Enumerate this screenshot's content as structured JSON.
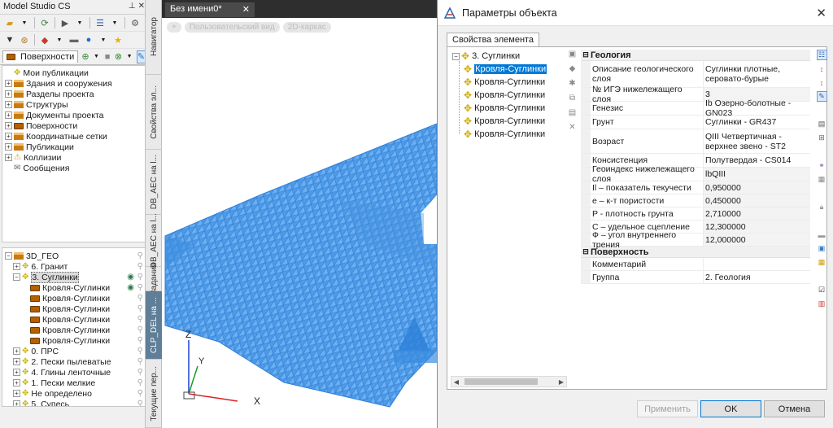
{
  "left_panel": {
    "title": "Model Studio CS",
    "pin_icons": [
      "pin-icon",
      "close-icon"
    ],
    "surface_tab_label": "Поверхности",
    "tree_items": [
      {
        "label": "Мои публикации",
        "exp": "",
        "icon": "star"
      },
      {
        "label": "Здания и сооружения",
        "exp": "+",
        "icon": "folder"
      },
      {
        "label": "Разделы проекта",
        "exp": "+",
        "icon": "folder"
      },
      {
        "label": "Структуры",
        "exp": "+",
        "icon": "folder"
      },
      {
        "label": "Документы проекта",
        "exp": "+",
        "icon": "folder"
      },
      {
        "label": "Поверхности",
        "exp": "+",
        "icon": "layer"
      },
      {
        "label": "Координатные сетки",
        "exp": "+",
        "icon": "folder"
      },
      {
        "label": "Публикации",
        "exp": "+",
        "icon": "folder"
      },
      {
        "label": "Коллизии",
        "exp": "+",
        "icon": "warning"
      },
      {
        "label": "Сообщения",
        "exp": "",
        "icon": "mail"
      }
    ],
    "layer_tree": [
      {
        "label": "3D_ГЕО",
        "exp": "−",
        "level": 0,
        "icon": "folder"
      },
      {
        "label": "6. Гранит",
        "exp": "+",
        "level": 1,
        "icon": "star"
      },
      {
        "label": "3. Суглинки",
        "exp": "−",
        "level": 1,
        "icon": "star",
        "selected": true,
        "eye": true
      },
      {
        "label": "Кровля-Суглинки",
        "exp": "",
        "level": 2,
        "icon": "layer",
        "eye": true
      },
      {
        "label": "Кровля-Суглинки",
        "exp": "",
        "level": 2,
        "icon": "layer"
      },
      {
        "label": "Кровля-Суглинки",
        "exp": "",
        "level": 2,
        "icon": "layer"
      },
      {
        "label": "Кровля-Суглинки",
        "exp": "",
        "level": 2,
        "icon": "layer"
      },
      {
        "label": "Кровля-Суглинки",
        "exp": "",
        "level": 2,
        "icon": "layer"
      },
      {
        "label": "Кровля-Суглинки",
        "exp": "",
        "level": 2,
        "icon": "layer"
      },
      {
        "label": "0. ПРС",
        "exp": "+",
        "level": 1,
        "icon": "star"
      },
      {
        "label": "2. Пески пылеватые",
        "exp": "+",
        "level": 1,
        "icon": "star"
      },
      {
        "label": "4. Глины ленточные",
        "exp": "+",
        "level": 1,
        "icon": "star"
      },
      {
        "label": "1. Пески мелкие",
        "exp": "+",
        "level": 1,
        "icon": "star"
      },
      {
        "label": "Не определено",
        "exp": "+",
        "level": 1,
        "icon": "star"
      },
      {
        "label": "5. Супесь",
        "exp": "+",
        "level": 1,
        "icon": "star"
      }
    ]
  },
  "vertical_tabs": [
    "Навигатор",
    "Свойства эл...",
    "DB_AEC на l...",
    "DB_AEC на l...",
    "Задания",
    "CLP_DEL на ...",
    "Текущие пер..."
  ],
  "viewport": {
    "doc_tab": "Без имени0*",
    "chips": [
      "+",
      "Пользовательский вид",
      "2D-каркас"
    ],
    "axes": {
      "z": "Z",
      "y": "Y",
      "x": "X"
    },
    "mesh_color": "#4f9ae6"
  },
  "dialog": {
    "title": "Параметры объекта",
    "tab": "Свойства элемента",
    "element_tree": [
      {
        "label": "3. Суглинки",
        "exp": "−",
        "level": 0
      },
      {
        "label": "Кровля-Суглинки",
        "level": 1,
        "selected": true
      },
      {
        "label": "Кровля-Суглинки",
        "level": 1
      },
      {
        "label": "Кровля-Суглинки",
        "level": 1
      },
      {
        "label": "Кровля-Суглинки",
        "level": 1
      },
      {
        "label": "Кровля-Суглинки",
        "level": 1
      },
      {
        "label": "Кровля-Суглинки",
        "level": 1
      }
    ],
    "groups": [
      {
        "name": "Геология",
        "rows": [
          {
            "k": "Описание геологического слоя",
            "v": "Суглинки плотные, серовато-бурые",
            "h": 33
          },
          {
            "k": "№ ИГЭ нижележащего слоя",
            "v": "3",
            "h": 17
          },
          {
            "k": "Генезис",
            "v": "Ib Озерно-болотные - GN023",
            "h": 17
          },
          {
            "k": "Грунт",
            "v": "Суглинки - GR437",
            "h": 17
          },
          {
            "k": "Возраст",
            "v": "QIII Четвертичная - верхнее звено - ST2",
            "h": 30
          },
          {
            "k": "Консистенция",
            "v": "Полутвердая - CS014",
            "h": 17
          },
          {
            "k": "Геоиндекс нижележащего слоя",
            "v": "lbQIII",
            "h": 17
          },
          {
            "k": "Il – показатель текучести",
            "v": "0,950000",
            "h": 16
          },
          {
            "k": "e – к-т пористости",
            "v": "0,450000",
            "h": 16
          },
          {
            "k": "P - плотность грунта",
            "v": "2,710000",
            "h": 16
          },
          {
            "k": "C – удельное сцепление",
            "v": "12,300000",
            "h": 16
          },
          {
            "k": "Ф – угол внутреннего трения",
            "v": "12,000000",
            "h": 16
          }
        ]
      },
      {
        "name": "Поверхность",
        "rows": [
          {
            "k": "Комментарий",
            "v": "",
            "h": 16
          },
          {
            "k": "Группа",
            "v": "2. Геология",
            "h": 16
          }
        ]
      }
    ],
    "buttons": {
      "apply": "Применить",
      "ok": "OK",
      "cancel": "Отмена"
    }
  }
}
